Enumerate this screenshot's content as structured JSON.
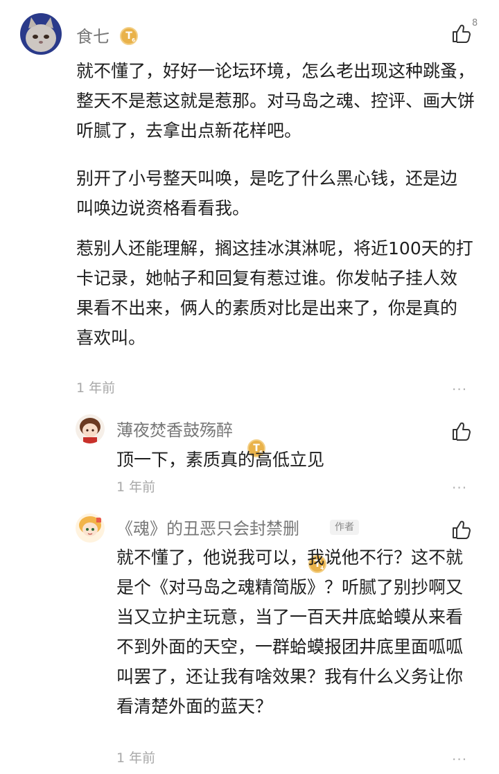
{
  "main_comment": {
    "username": "食七",
    "badge": "T",
    "badge_sub": "6",
    "like_count": "8",
    "paragraphs": [
      [
        "就不懂了，好好一论坛环境，怎么老出现这种跳蚤，",
        "整天不是惹这就是惹那。对马岛之魂、控评、画大饼",
        "听腻了，去拿出点新花样吧。"
      ],
      [
        "别开了小号整天叫唤，是吃了什么黑心钱，还是边",
        "叫唤边说资格看看我。"
      ],
      [
        "惹别人还能理解，搁这挂冰淇淋呢，将近100天的打",
        "卡记录，她帖子和回复有惹过谁。你发帖子挂人效",
        "果看不出来，俩人的素质对比是出来了，你是真的",
        "喜欢叫。"
      ]
    ],
    "time": "1 年前",
    "more_icon": "···"
  },
  "replies": [
    {
      "username": "薄夜焚香鼓殇醉",
      "badge": "T",
      "badge_sub": "6",
      "lines": [
        "顶一下，素质真的高低立见"
      ],
      "time": "1 年前",
      "more_icon": "···"
    },
    {
      "username": "《魂》的丑恶只会封禁删",
      "badge": "T",
      "badge_sub": "4",
      "author_tag": "作者",
      "lines": [
        "就不懂了，他说我可以，我说他不行？这不就",
        "是个《对马岛之魂精简版》？听腻了别抄啊又",
        "当又立护主玩意，当了一百天井底蛤蟆从来看",
        "不到外面的天空，一群蛤蟆报团井底里面呱呱",
        "叫罢了，还让我有啥效果？我有什么义务让你",
        "看清楚外面的蓝天？"
      ],
      "time": "1 年前",
      "more_icon": "···"
    }
  ],
  "colors": {
    "badge_gold": "#e9b24a",
    "meta_gray": "#a8a8a8",
    "name_gray": "#777777"
  },
  "icons": {
    "like": "thumbs-up-icon",
    "more": "more-dots-icon"
  }
}
